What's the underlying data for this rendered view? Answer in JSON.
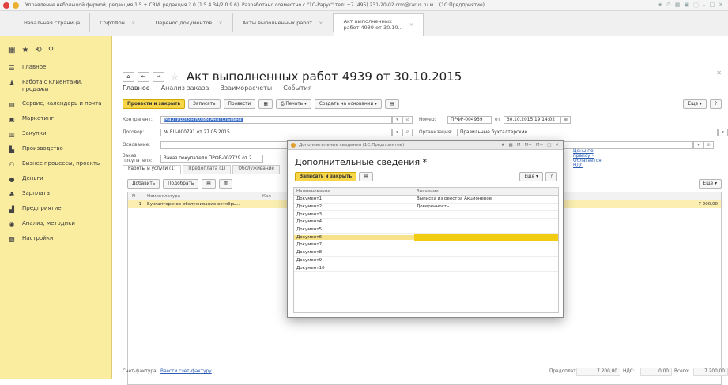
{
  "window": {
    "title": "Управление небольшой фирмой, редакция 1.5 + CRM, редакция 2.0 (1.5.4.34/2.0.9.6). Разработано совместно с \"1С-Рарус\" тел: +7 (495) 231-20-02 crm@rarus.ru м... (1С:Предприятие)"
  },
  "open_tabs": [
    {
      "label": "Начальная страница"
    },
    {
      "label": "СофтФон"
    },
    {
      "label": "Перенос документов"
    },
    {
      "label": "Акты выполненных работ"
    },
    {
      "label": "Акт выполненных",
      "label2": "работ 4939 от 30.10..."
    }
  ],
  "sidebar": {
    "items": [
      {
        "label": "Главное",
        "icon": "menu-icon"
      },
      {
        "label": "Работа с клиентами, продажи",
        "icon": "sales-icon"
      },
      {
        "label": "Сервис, календарь и почта",
        "icon": "calendar-icon"
      },
      {
        "label": "Маркетинг",
        "icon": "marketing-icon"
      },
      {
        "label": "Закупки",
        "icon": "purchase-icon"
      },
      {
        "label": "Производство",
        "icon": "production-icon"
      },
      {
        "label": "Бизнес процессы, проекты",
        "icon": "process-icon"
      },
      {
        "label": "Деньги",
        "icon": "money-icon"
      },
      {
        "label": "Зарплата",
        "icon": "salary-icon"
      },
      {
        "label": "Предприятие",
        "icon": "enterprise-icon"
      },
      {
        "label": "Анализ, методики",
        "icon": "analysis-icon"
      },
      {
        "label": "Настройки",
        "icon": "settings-icon"
      }
    ]
  },
  "form": {
    "title": "Акт выполненных работ 4939 от 30.10.2015",
    "subnav": [
      "Главное",
      "Анализ заказа",
      "Взаиморасчеты",
      "События"
    ],
    "toolbar": {
      "post_close": "Провести и закрыть",
      "save": "Записать",
      "post": "Провести",
      "print": "Печать",
      "create_based": "Создать на основании",
      "more": "Еще",
      "help": "?"
    },
    "fields": {
      "counterparty_label": "Контрагент:",
      "counterparty": "Мартиросян Юлия Анатольевна",
      "number_label": "Номер:",
      "number": "ПРФР-004939",
      "date_prefix": "от",
      "date": "30.10.2015 19:14:02",
      "contract_label": "Договор:",
      "contract": "№ EU-000791 от 27.05.2015",
      "org_label": "Организация:",
      "org": "Правильные бухгалтерские",
      "basis_label": "Основание:",
      "order_label": "Заказ покупателя:",
      "order": "Заказ покупателя ПРФР-002729 от 2...",
      "price_link": "Цены по прайсу • Облагается НДС"
    },
    "tabs": [
      "Работы и услуги (1)",
      "Предоплата (1)",
      "Обслуживание"
    ],
    "table_toolbar": {
      "add": "Добавить",
      "pick": "Подобрать",
      "more": "Еще"
    },
    "table": {
      "headers": [
        "N",
        "Номенклатура",
        "Кол"
      ],
      "rows": [
        {
          "n": "1",
          "item": "Бухгалтерское обслуживание октябрь...",
          "sum": "7 200,00"
        }
      ]
    },
    "footer": {
      "invoice_label": "Счет-фактура:",
      "invoice_link": "Ввести счет-фактуру",
      "prepay_label": "Предоплата:",
      "prepay": "7 200,00",
      "vat_label": "НДС:",
      "vat": "0,00",
      "total_label": "Всего:",
      "total": "7 200,00"
    }
  },
  "modal": {
    "window_title": "Дополнительные сведения (1С:Предприятие)",
    "title": "Дополнительные сведения *",
    "save_close": "Записать и закрыть",
    "more": "Еще",
    "help": "?",
    "headers": [
      "Наименование",
      "Значение"
    ],
    "rows": [
      {
        "name": "Документ1",
        "value": "Выписка из реестра Акционеров"
      },
      {
        "name": "Документ2",
        "value": "Доверенность"
      },
      {
        "name": "Документ3",
        "value": ""
      },
      {
        "name": "Документ4",
        "value": ""
      },
      {
        "name": "Документ5",
        "value": ""
      },
      {
        "name": "Документ6",
        "value": ""
      },
      {
        "name": "Документ7",
        "value": ""
      },
      {
        "name": "Документ8",
        "value": ""
      },
      {
        "name": "Документ9",
        "value": ""
      },
      {
        "name": "Документ10",
        "value": ""
      }
    ],
    "selected_row": 5
  }
}
